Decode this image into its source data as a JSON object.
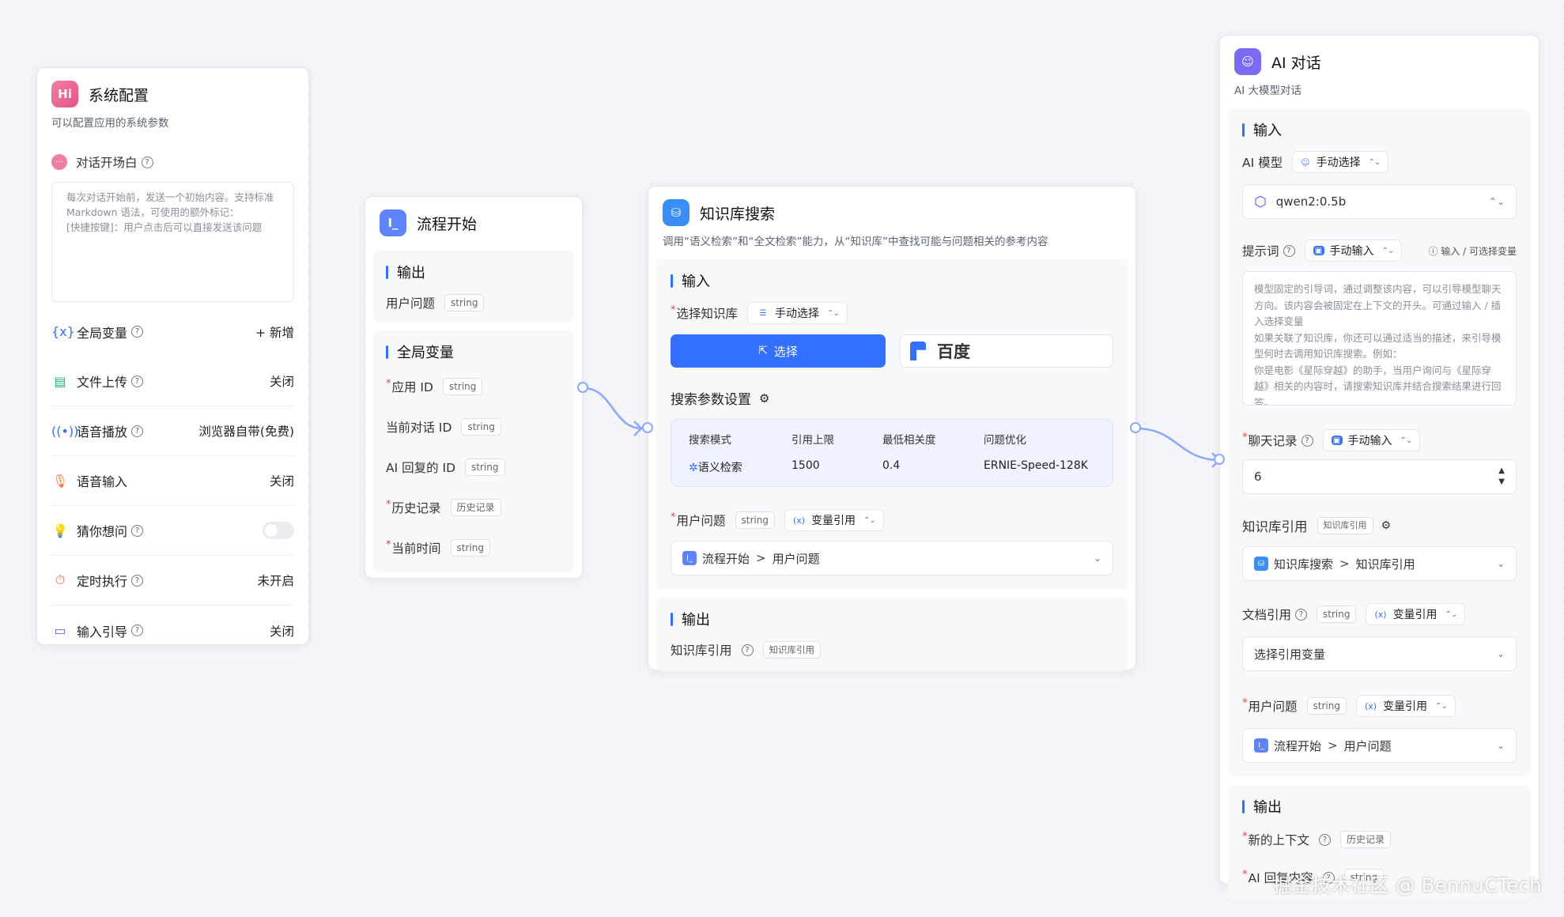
{
  "sys": {
    "title": "系统配置",
    "desc": "可以配置应用的系统参数",
    "opening_label": "对话开场白",
    "opening_placeholder": "每次对话开始前，发送一个初始内容。支持标准 Markdown 语法，可使用的额外标记：\n[快捷按键]：用户点击后可以直接发送该问题",
    "rows": [
      {
        "label": "全局变量",
        "value": "+ 新增"
      },
      {
        "label": "文件上传",
        "value": "关闭"
      },
      {
        "label": "语音播放",
        "value": "浏览器自带(免费)"
      },
      {
        "label": "语音输入",
        "value": "关闭"
      },
      {
        "label": "猜你想问",
        "value": ""
      },
      {
        "label": "定时执行",
        "value": "未开启"
      },
      {
        "label": "输入引导",
        "value": "关闭"
      }
    ]
  },
  "start": {
    "title": "流程开始",
    "output_label": "输出",
    "user_question": "用户问题",
    "string": "string",
    "global_label": "全局变量",
    "vars": [
      {
        "label": "应用 ID",
        "tag": "string"
      },
      {
        "label": "当前对话 ID",
        "tag": "string"
      },
      {
        "label": "AI 回复的 ID",
        "tag": "string"
      },
      {
        "label": "历史记录",
        "tag": "历史记录"
      },
      {
        "label": "当前时间",
        "tag": "string"
      }
    ]
  },
  "kb": {
    "title": "知识库搜索",
    "desc": "调用“语义检索”和“全文检索”能力，从“知识库”中查找可能与问题相关的参考内容",
    "input_label": "输入",
    "select_kb": "选择知识库",
    "manual": "手动选择",
    "choose_btn": "选择",
    "baidu": "百度",
    "search_params": "搜索参数设置",
    "headers": [
      "搜索模式",
      "引用上限",
      "最低相关度",
      "问题优化"
    ],
    "values": [
      "语义检索",
      "1500",
      "0.4",
      "ERNIE-Speed-128K"
    ],
    "user_question": "用户问题",
    "string": "string",
    "var_ref": "变量引用",
    "ref_node": "流程开始",
    "ref_field": "用户问题",
    "output_label": "输出",
    "kb_ref": "知识库引用",
    "kb_ref_tag": "知识库引用"
  },
  "ai": {
    "title": "AI 对话",
    "desc": "AI 大模型对话",
    "input_label": "输入",
    "model_label": "AI 模型",
    "manual_select": "手动选择",
    "model": "qwen2:0.5b",
    "prompt_label": "提示词",
    "manual_input": "手动输入",
    "prompt_hint": "输入 / 可选择变量",
    "prompt_placeholder": "模型固定的引导词，通过调整该内容，可以引导模型聊天方向。该内容会被固定在上下文的开头。可通过输入 / 插入选择变量\n如果关联了知识库，你还可以通过适当的描述，来引导模型何时去调用知识库搜索。例如：\n你是电影《星际穿越》的助手，当用户询问与《星际穿越》相关的内容时，请搜索知识库并结合搜索结果进行回答。",
    "history_label": "聊天记录",
    "history_value": "6",
    "kb_ref_label": "知识库引用",
    "kb_ref_tag": "知识库引用",
    "kb_ref_node": "知识库搜索",
    "kb_ref_field": "知识库引用",
    "doc_ref_label": "文档引用",
    "string": "string",
    "var_ref": "变量引用",
    "doc_placeholder": "选择引用变量",
    "uq_label": "用户问题",
    "uq_node": "流程开始",
    "uq_field": "用户问题",
    "output_label": "输出",
    "out1": "新的上下文",
    "out1_tag": "历史记录",
    "out2": "AI 回复内容",
    "out2_tag": "string"
  },
  "watermark": "掘金技术社区 @ BennuCTech"
}
